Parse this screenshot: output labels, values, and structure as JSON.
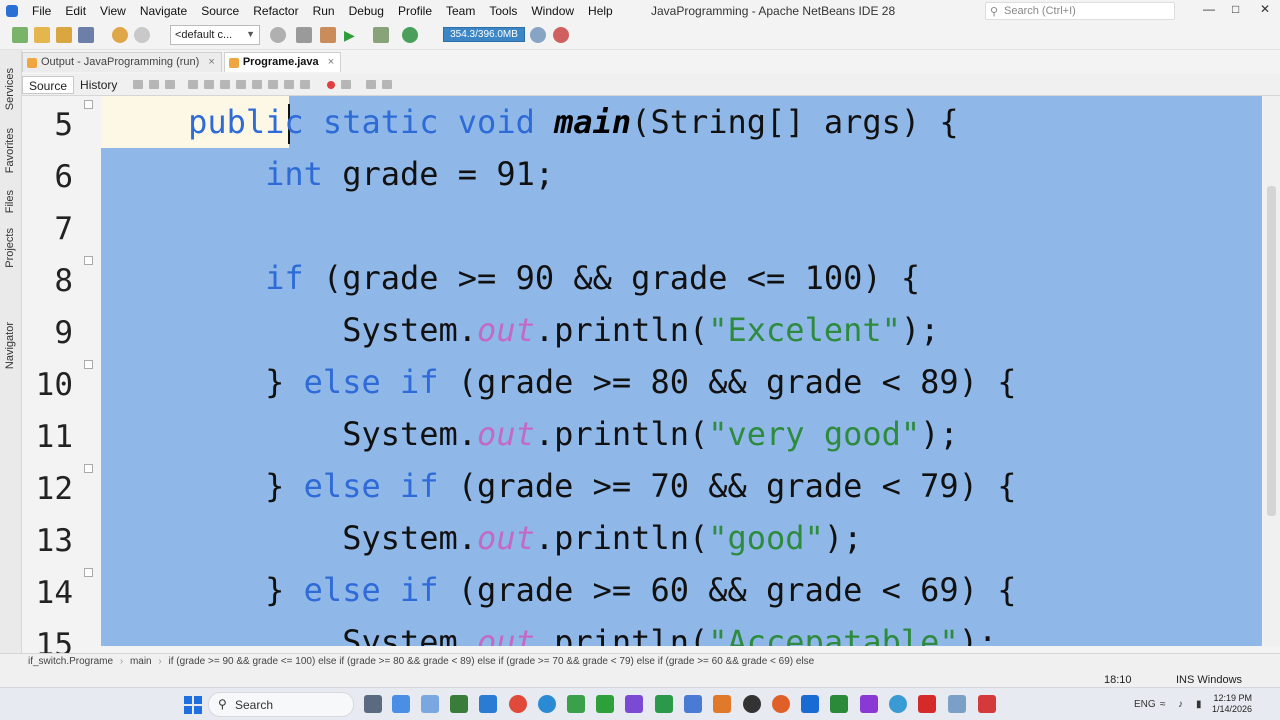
{
  "menubar": {
    "items": [
      "File",
      "Edit",
      "View",
      "Navigate",
      "Source",
      "Refactor",
      "Run",
      "Debug",
      "Profile",
      "Team",
      "Tools",
      "Window",
      "Help"
    ],
    "window_title": "JavaProgramming - Apache NetBeans IDE 28",
    "search_placeholder": "Search (Ctrl+I)"
  },
  "toolbar": {
    "config": "<default c...",
    "memory": "354.3/396.0MB"
  },
  "side_tabs": [
    "Services",
    "Favorites",
    "Files",
    "Projects",
    "Navigator"
  ],
  "tabs": [
    {
      "label": "Output - JavaProgramming (run)",
      "close": "×"
    },
    {
      "label": "Programe.java",
      "close": "×"
    }
  ],
  "editor_toolbar": {
    "source": "Source",
    "history": "History"
  },
  "editor": {
    "line_numbers": [
      "5",
      "6",
      "7",
      "8",
      "9",
      "10",
      "11",
      "12",
      "13",
      "14",
      "15"
    ],
    "lines": [
      [
        [
          "    ",
          ""
        ],
        [
          "public",
          "kw"
        ],
        [
          " ",
          ""
        ],
        [
          "static",
          "kw"
        ],
        [
          " ",
          ""
        ],
        [
          "void",
          "kw"
        ],
        [
          " ",
          ""
        ],
        [
          "main",
          "mth"
        ],
        [
          "(String[] args) {",
          ""
        ]
      ],
      [
        [
          "        ",
          ""
        ],
        [
          "int",
          "kw"
        ],
        [
          " grade = 91;",
          ""
        ]
      ],
      [
        [
          "",
          ""
        ]
      ],
      [
        [
          "        ",
          ""
        ],
        [
          "if",
          "kw"
        ],
        [
          " (grade >= 90 && grade <= 100) {",
          ""
        ]
      ],
      [
        [
          "            System.",
          ""
        ],
        [
          "out",
          "fld"
        ],
        [
          ".println(",
          ""
        ],
        [
          "\"Excelent\"",
          "str"
        ],
        [
          ");",
          ""
        ]
      ],
      [
        [
          "        } ",
          ""
        ],
        [
          "else",
          "kw"
        ],
        [
          " ",
          ""
        ],
        [
          "if",
          "kw"
        ],
        [
          " (grade >= 80 && grade < 89) {",
          ""
        ]
      ],
      [
        [
          "            System.",
          ""
        ],
        [
          "out",
          "fld"
        ],
        [
          ".println(",
          ""
        ],
        [
          "\"very good\"",
          "str"
        ],
        [
          ");",
          ""
        ]
      ],
      [
        [
          "        } ",
          ""
        ],
        [
          "else",
          "kw"
        ],
        [
          " ",
          ""
        ],
        [
          "if",
          "kw"
        ],
        [
          " (grade >= 70 && grade < 79) {",
          ""
        ]
      ],
      [
        [
          "            System.",
          ""
        ],
        [
          "out",
          "fld"
        ],
        [
          ".println(",
          ""
        ],
        [
          "\"good\"",
          "str"
        ],
        [
          ");",
          ""
        ]
      ],
      [
        [
          "        } ",
          ""
        ],
        [
          "else",
          "kw"
        ],
        [
          " ",
          ""
        ],
        [
          "if",
          "kw"
        ],
        [
          " (grade >= 60 && grade < 69) {",
          ""
        ]
      ],
      [
        [
          "            System.",
          ""
        ],
        [
          "out",
          "fld"
        ],
        [
          ".println(",
          ""
        ],
        [
          "\"Accepatable\"",
          "str"
        ],
        [
          ");",
          ""
        ]
      ]
    ]
  },
  "statusbar": {
    "crumb_class": "if_switch.Programe",
    "crumb_method": "main",
    "crumb_path": "if (grade >= 90 && grade <= 100) else if (grade >= 80 && grade < 89) else if (grade >= 70 && grade < 79) else if (grade >= 60 && grade < 69) else",
    "position": "18:10",
    "mode": "INS Windows (CRLF)"
  },
  "taskbar": {
    "search": "Search",
    "lang": "ENG",
    "time": "12:19 PM",
    "date": "1/14/2026"
  }
}
